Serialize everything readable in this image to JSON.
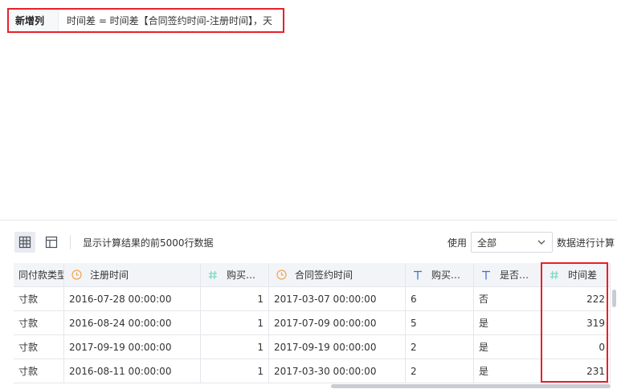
{
  "formula": {
    "label": "新增列",
    "expression": "时间差 = 时间差【合同签约时间-注册时间】，天"
  },
  "toolbar": {
    "info": "显示计算结果的前5000行数据",
    "use_label": "使用",
    "scope_value": "全部",
    "suffix": "数据进行计算"
  },
  "table": {
    "headers": [
      {
        "label": "同付款类型",
        "icon": "none"
      },
      {
        "label": "注册时间",
        "icon": "clock-icon"
      },
      {
        "label": "购买…",
        "icon": "hash-icon"
      },
      {
        "label": "合同签约时间",
        "icon": "clock-icon"
      },
      {
        "label": "购买…",
        "icon": "text-icon"
      },
      {
        "label": "是否…",
        "icon": "text-icon"
      },
      {
        "label": "时间差",
        "icon": "hash-icon"
      }
    ],
    "rows": [
      [
        "寸款",
        "2016-07-28 00:00:00",
        "1",
        "2017-03-07 00:00:00",
        "6",
        "否",
        "222"
      ],
      [
        "寸款",
        "2016-08-24 00:00:00",
        "1",
        "2017-07-09 00:00:00",
        "5",
        "是",
        "319"
      ],
      [
        "寸款",
        "2017-09-19 00:00:00",
        "1",
        "2017-09-19 00:00:00",
        "2",
        "是",
        "0"
      ],
      [
        "寸款",
        "2016-08-11 00:00:00",
        "1",
        "2017-03-30 00:00:00",
        "2",
        "是",
        "231"
      ]
    ]
  },
  "colors": {
    "highlight": "#e8202a",
    "clock_icon": "#f0a44b",
    "hash_icon": "#7fd3c4",
    "text_icon": "#3a72d9"
  }
}
